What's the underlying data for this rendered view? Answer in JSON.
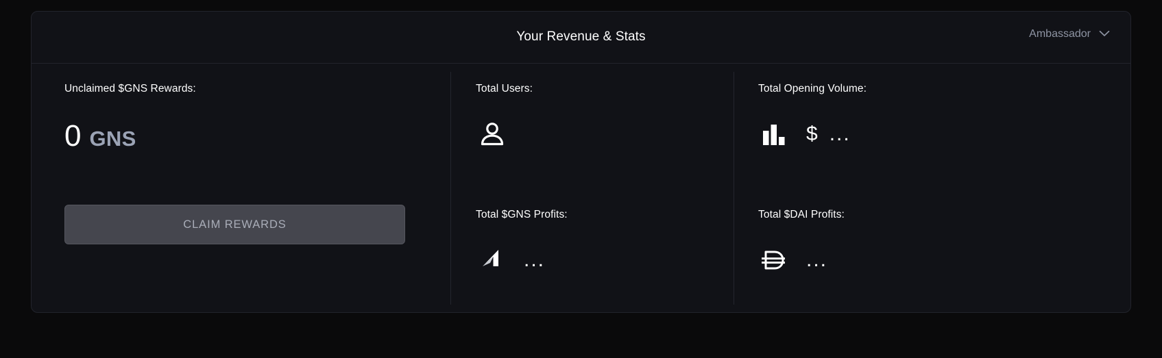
{
  "header": {
    "title": "Your Revenue & Stats",
    "role_label": "Ambassador",
    "chevron_icon": "chevron-down-icon"
  },
  "stats": {
    "unclaimed": {
      "label": "Unclaimed $GNS Rewards:",
      "amount": "0",
      "unit": "GNS"
    },
    "claim_button": "CLAIM REWARDS",
    "total_users": {
      "label": "Total Users:",
      "icon": "user-icon",
      "value": ""
    },
    "opening_volume": {
      "label": "Total Opening Volume:",
      "icon": "bar-chart-icon",
      "currency": "$",
      "value": "..."
    },
    "gns_profits": {
      "label": "Total $GNS Profits:",
      "icon": "gains-network-logo-icon",
      "value": "..."
    },
    "dai_profits": {
      "label": "Total $DAI Profits:",
      "icon": "dai-logo-icon",
      "value": "..."
    }
  },
  "colors": {
    "page_background": "#0a0a0b",
    "card_background": "#111217",
    "border": "#22242c",
    "text_primary": "#ffffff",
    "text_muted": "#8e94a3",
    "unit_color": "#9ba3b5",
    "button_background": "#45464e",
    "button_text": "#a9adb8"
  }
}
